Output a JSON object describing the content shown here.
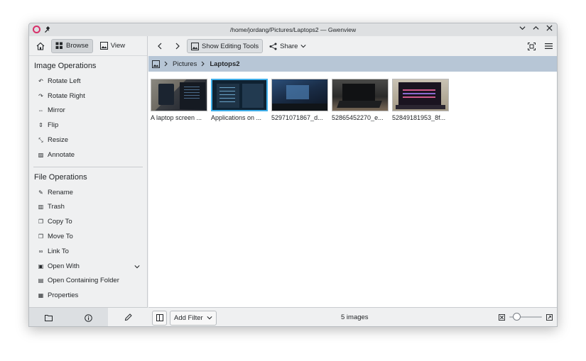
{
  "window": {
    "title": "/home/jordang/Pictures/Laptops2 — Gwenview",
    "app_icon": "gwenview-icon",
    "pin_icon": "pin-icon",
    "controls": [
      "chevron-down-icon",
      "chevron-up-icon",
      "close-icon"
    ]
  },
  "sidebar": {
    "home_icon": "home-icon",
    "modes": [
      {
        "label": "Browse",
        "icon": "browse-icon",
        "active": true
      },
      {
        "label": "View",
        "icon": "image-icon",
        "active": false
      }
    ],
    "image_ops_title": "Image Operations",
    "image_ops": [
      {
        "label": "Rotate Left",
        "icon": "rotate-left-icon"
      },
      {
        "label": "Rotate Right",
        "icon": "rotate-right-icon"
      },
      {
        "label": "Mirror",
        "icon": "mirror-icon"
      },
      {
        "label": "Flip",
        "icon": "flip-icon"
      },
      {
        "label": "Resize",
        "icon": "resize-icon"
      },
      {
        "label": "Annotate",
        "icon": "annotate-icon"
      }
    ],
    "file_ops_title": "File Operations",
    "file_ops": [
      {
        "label": "Rename",
        "icon": "rename-icon"
      },
      {
        "label": "Trash",
        "icon": "trash-icon"
      },
      {
        "label": "Copy To",
        "icon": "copy-icon"
      },
      {
        "label": "Move To",
        "icon": "move-icon"
      },
      {
        "label": "Link To",
        "icon": "link-icon"
      },
      {
        "label": "Open With",
        "icon": "open-with-icon"
      },
      {
        "label": "Open Containing Folder",
        "icon": "folder-open-icon"
      },
      {
        "label": "Properties",
        "icon": "properties-icon"
      }
    ],
    "bottom_tabs": [
      "folder-icon",
      "info-icon",
      "pencil-icon"
    ]
  },
  "toolbar": {
    "back_icon": "chevron-left-icon",
    "forward_icon": "chevron-right-icon",
    "editing_tools_label": "Show Editing Tools",
    "share_label": "Share",
    "fullscreen_icon": "fullscreen-icon",
    "menu_icon": "hamburger-menu-icon"
  },
  "breadcrumb": {
    "places_icon": "places-icon",
    "items": [
      "Pictures",
      "Laptops2"
    ]
  },
  "thumbnails": [
    {
      "caption": "A laptop screen ...",
      "selected": false
    },
    {
      "caption": "Applications on ...",
      "selected": true
    },
    {
      "caption": "52971071867_d...",
      "selected": false
    },
    {
      "caption": "52865452270_e...",
      "selected": false
    },
    {
      "caption": "52849181953_8f...",
      "selected": false
    }
  ],
  "statusbar": {
    "add_filter_label": "Add Filter",
    "count_text": "5 images",
    "zoom_level": 0.15
  },
  "colors": {
    "accent": "#3daee9",
    "breadcrumb_bg": "#b7c6d6",
    "app_icon": "#d8306a"
  }
}
